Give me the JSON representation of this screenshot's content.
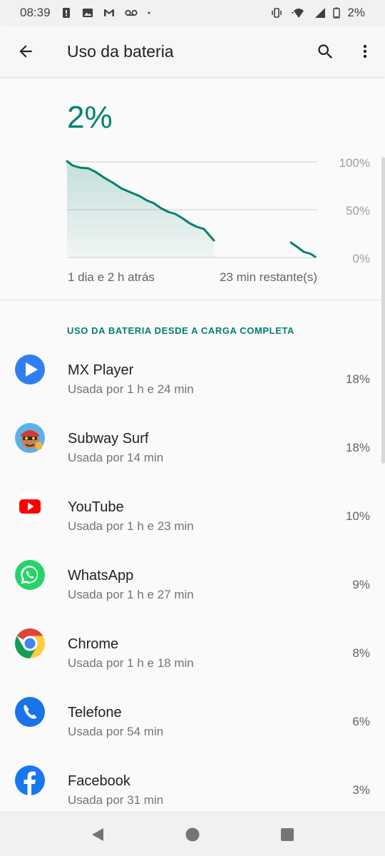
{
  "status_bar": {
    "time": "08:39",
    "battery_text": "2%"
  },
  "app_bar": {
    "title": "Uso da bateria"
  },
  "battery": {
    "level_text": "2%",
    "chart": {
      "y_labels": [
        "100%",
        "50%",
        "0%"
      ],
      "x_start_label": "1 dia e 2 h atrás",
      "x_end_label": "23 min restante(s)"
    }
  },
  "section": {
    "title": "USO DA BATERIA DESDE A CARGA COMPLETA"
  },
  "apps": [
    {
      "name": "MX Player",
      "usage": "Usada por 1 h e 24 min",
      "percent": "18%",
      "icon": "mx-player-icon"
    },
    {
      "name": "Subway Surf",
      "usage": "Usada por 14 min",
      "percent": "18%",
      "icon": "subway-surf-icon"
    },
    {
      "name": "YouTube",
      "usage": "Usada por 1 h e 23 min",
      "percent": "10%",
      "icon": "youtube-icon"
    },
    {
      "name": "WhatsApp",
      "usage": "Usada por 1 h e 27 min",
      "percent": "9%",
      "icon": "whatsapp-icon"
    },
    {
      "name": "Chrome",
      "usage": "Usada por 1 h e 18 min",
      "percent": "8%",
      "icon": "chrome-icon"
    },
    {
      "name": "Telefone",
      "usage": "Usada por 54 min",
      "percent": "6%",
      "icon": "phone-icon"
    },
    {
      "name": "Facebook",
      "usage": "Usada por 31 min",
      "percent": "3%",
      "icon": "facebook-icon"
    }
  ],
  "colors": {
    "accent": "#00806f",
    "chart_line": "#00806f"
  }
}
